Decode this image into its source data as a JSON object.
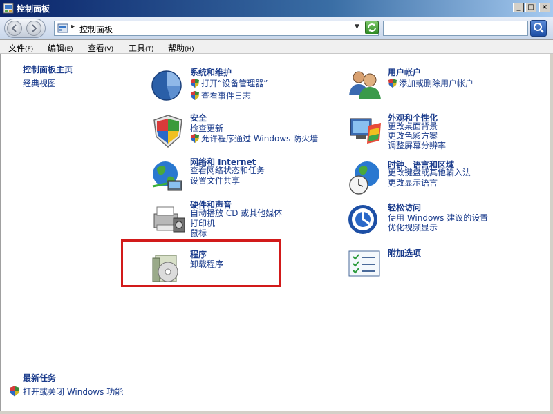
{
  "window": {
    "title": "控制面板"
  },
  "address": {
    "path": "控制面板"
  },
  "menu": [
    {
      "label": "文件",
      "accel": "(F)"
    },
    {
      "label": "编辑",
      "accel": "(E)"
    },
    {
      "label": "查看",
      "accel": "(V)"
    },
    {
      "label": "工具",
      "accel": "(T)"
    },
    {
      "label": "帮助",
      "accel": "(H)"
    }
  ],
  "left": {
    "home": "控制面板主页",
    "classic": "经典视图",
    "recent_title": "最新任务",
    "recent_item": "打开或关闭 Windows 功能"
  },
  "categories": {
    "system": {
      "title": "系统和维护",
      "links": [
        "打开“设备管理器”",
        "查看事件日志"
      ]
    },
    "security": {
      "title": "安全",
      "links": [
        "检查更新",
        "允许程序通过 Windows 防火墙"
      ]
    },
    "network": {
      "title": "网络和 Internet",
      "links": [
        "查看网络状态和任务",
        "设置文件共享"
      ]
    },
    "hardware": {
      "title": "硬件和声音",
      "links": [
        "自动播放 CD 或其他媒体",
        "打印机",
        "鼠标"
      ]
    },
    "programs": {
      "title": "程序",
      "links": [
        "卸载程序"
      ]
    },
    "users": {
      "title": "用户帐户",
      "links": [
        "添加或删除用户帐户"
      ]
    },
    "appearance": {
      "title": "外观和个性化",
      "links": [
        "更改桌面背景",
        "更改色彩方案",
        "调整屏幕分辨率"
      ]
    },
    "clock": {
      "title": "时钟、语言和区域",
      "links": [
        "更改键盘或其他输入法",
        "更改显示语言"
      ]
    },
    "ease": {
      "title": "轻松访问",
      "links": [
        "使用 Windows 建议的设置",
        "优化视频显示"
      ]
    },
    "additional": {
      "title": "附加选项",
      "links": []
    }
  },
  "colors": {
    "link": "#1b3c8c",
    "highlight": "#d21a1a"
  }
}
